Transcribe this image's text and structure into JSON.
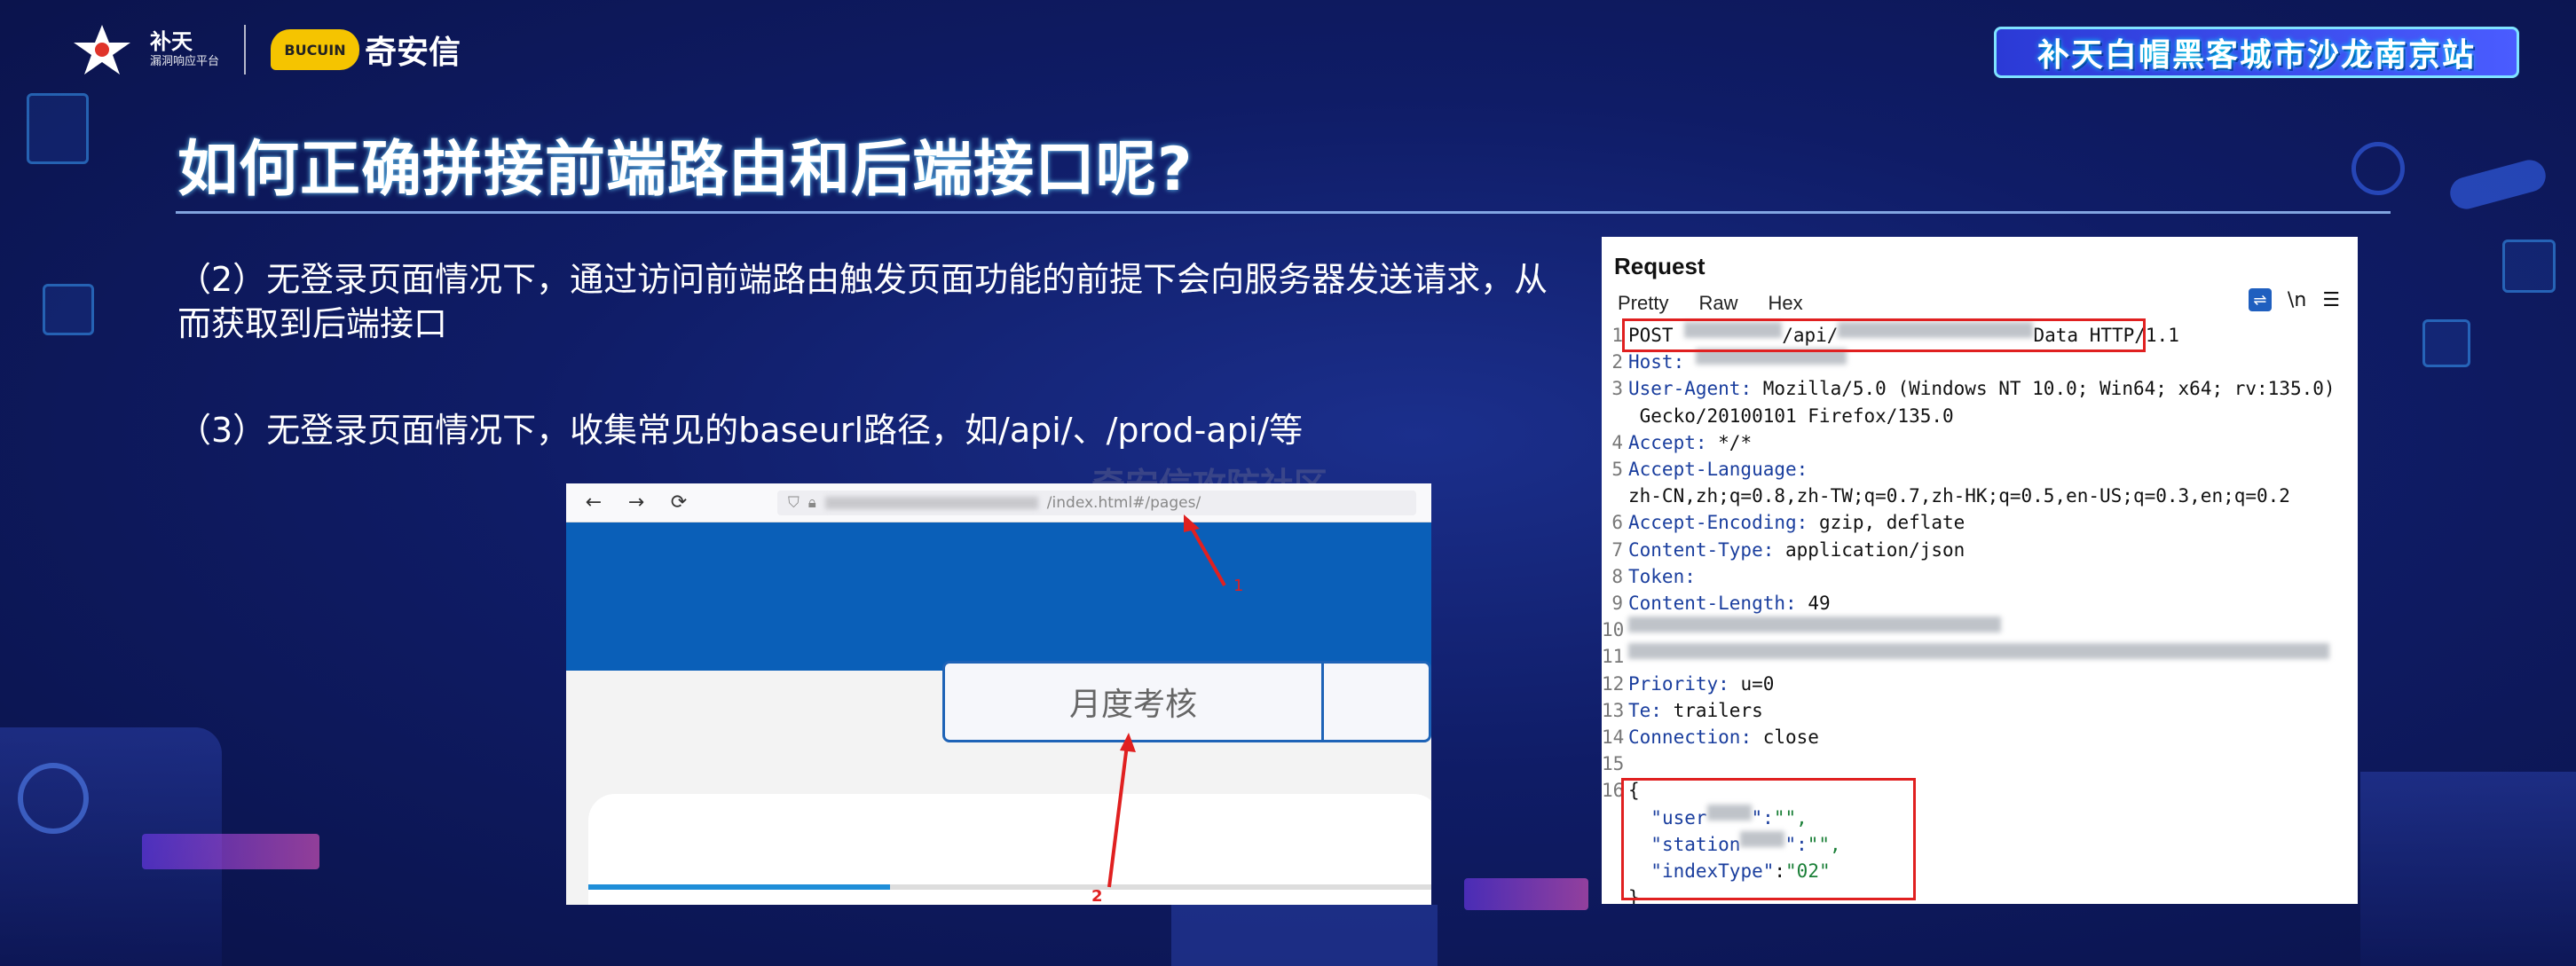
{
  "header": {
    "logo_left_name": "补天",
    "logo_left_sub": "漏洞响应平台",
    "logo_partner": "奇安信",
    "logo_partner_mark": "BUCUIN",
    "event_banner": "补天白帽黑客城市沙龙南京站"
  },
  "title": "如何正确拼接前端路由和后端接口呢?",
  "paragraphs": [
    "（2）无登录页面情况下，通过访问前端路由触发页面功能的前提下会向服务器发送请求，从而获取到后端接口",
    "（3）无登录页面情况下，收集常见的baseurl路径，如/api/、/prod-api/等"
  ],
  "browser": {
    "url_suffix": "/index.html#/pages/",
    "card_label": "月度考核",
    "annotations": [
      "1",
      "2"
    ]
  },
  "watermark": "奇安信攻防社区",
  "request": {
    "title": "Request",
    "tabs": [
      "Pretty",
      "Raw",
      "Hex"
    ],
    "icons": [
      "wrap-icon",
      "newline-icon",
      "menu-icon"
    ],
    "newline_label": "\\n",
    "lines": [
      {
        "no": "1",
        "method": "POST",
        "path_mid": "/api/",
        "path_end": "Data",
        "proto": "HTTP/1.1"
      },
      {
        "no": "2",
        "key": "Host",
        "val": ""
      },
      {
        "no": "3",
        "key": "User-Agent",
        "val": "Mozilla/5.0 (Windows NT 10.0; Win64; x64; rv:135.0)"
      },
      {
        "no": "",
        "key": "",
        "val": " Gecko/20100101 Firefox/135.0"
      },
      {
        "no": "4",
        "key": "Accept",
        "val": "*/*"
      },
      {
        "no": "5",
        "key": "Accept-Language",
        "val": ""
      },
      {
        "no": "",
        "key": "",
        "val": "zh-CN,zh;q=0.8,zh-TW;q=0.7,zh-HK;q=0.5,en-US;q=0.3,en;q=0.2"
      },
      {
        "no": "6",
        "key": "Accept-Encoding",
        "val": "gzip, deflate"
      },
      {
        "no": "7",
        "key": "Content-Type",
        "val": "application/json"
      },
      {
        "no": "8",
        "key": "Token",
        "val": ""
      },
      {
        "no": "9",
        "key": "Content-Length",
        "val": "49"
      },
      {
        "no": "10",
        "key": "",
        "val": ""
      },
      {
        "no": "11",
        "key": "",
        "val": ""
      },
      {
        "no": "12",
        "key": "Priority",
        "val": "u=0"
      },
      {
        "no": "13",
        "key": "Te",
        "val": "trailers"
      },
      {
        "no": "14",
        "key": "Connection",
        "val": "close"
      },
      {
        "no": "15",
        "key": "",
        "val": ""
      },
      {
        "no": "16",
        "key": "",
        "val": "{"
      }
    ],
    "body": {
      "user_key": "\"user",
      "user_val": "\"\",",
      "station_key": "\"station",
      "station_val": "\"\",",
      "index_key": "\"indexType\"",
      "index_val": "\"02\"",
      "close": "}"
    }
  }
}
